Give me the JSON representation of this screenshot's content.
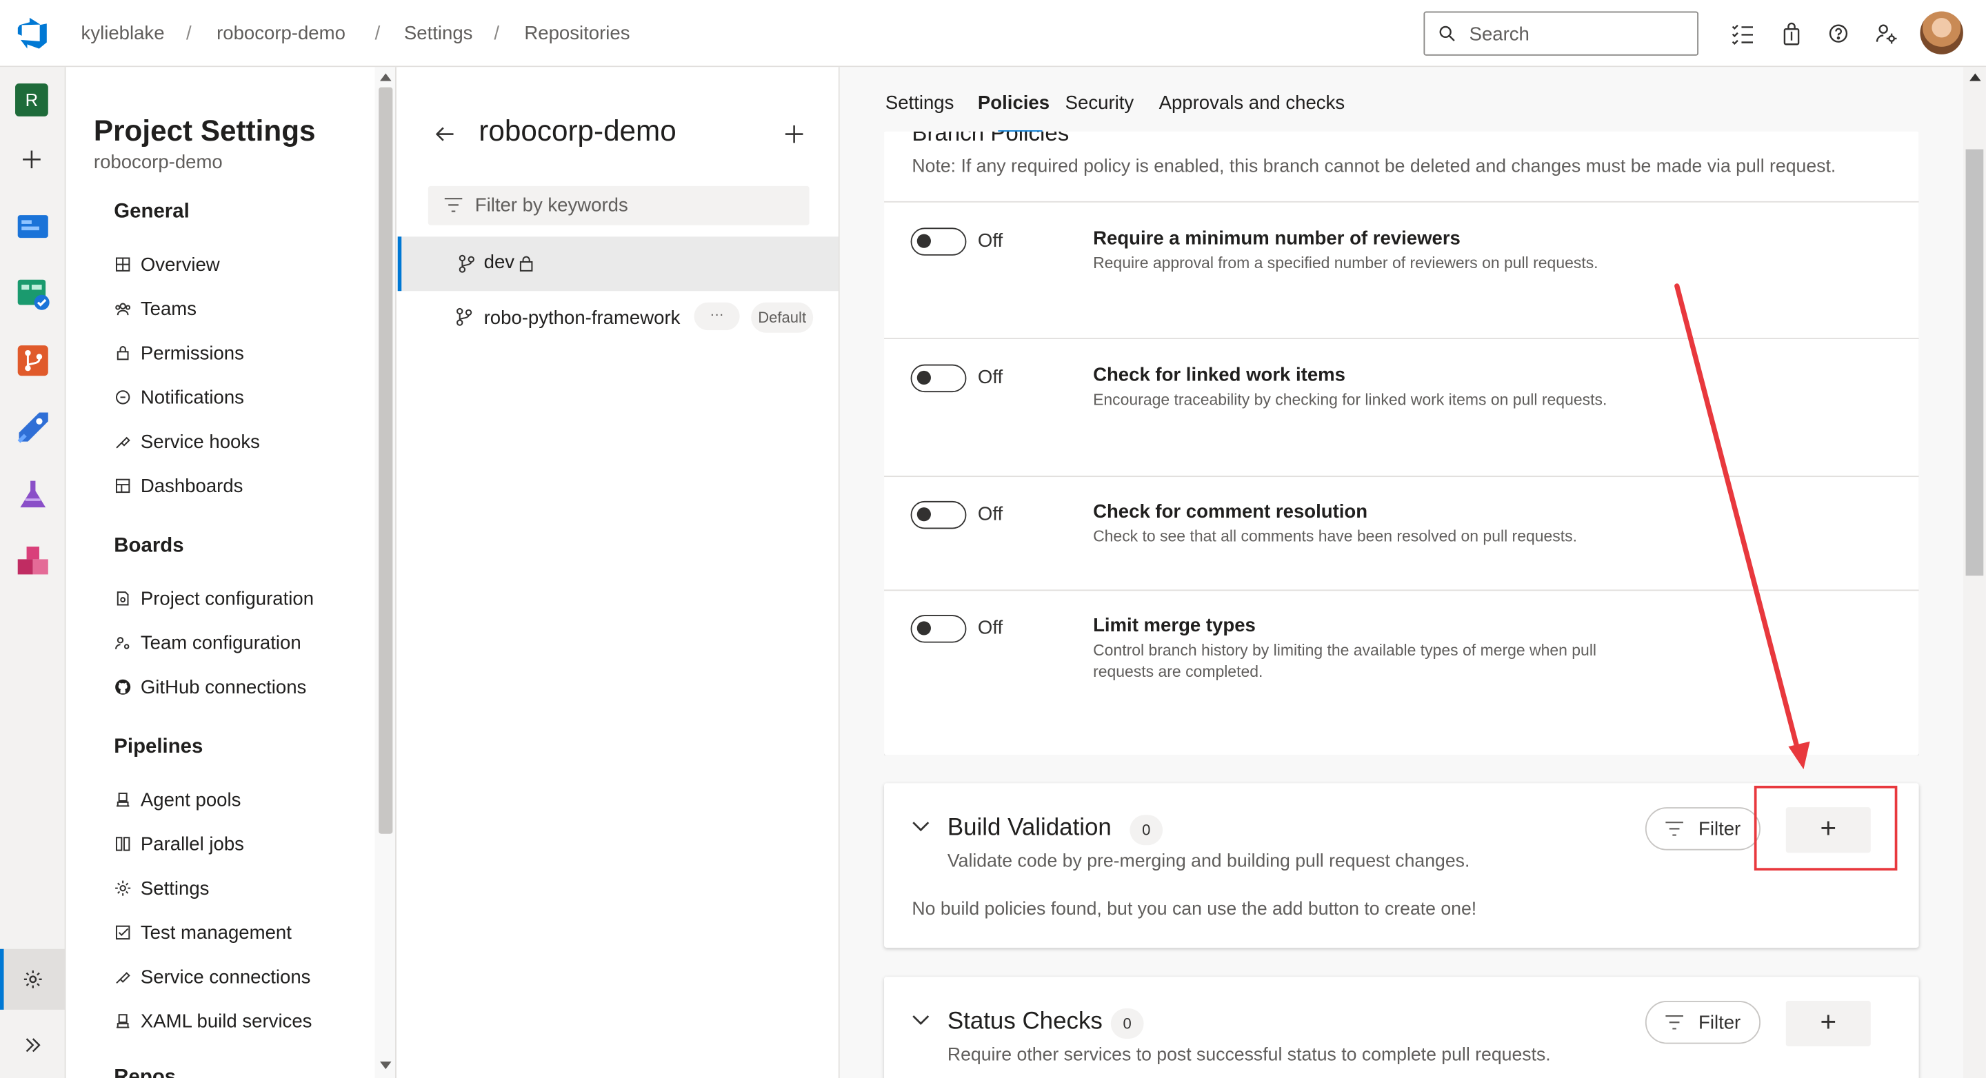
{
  "breadcrumb": {
    "org": "kylieblake",
    "project": "robocorp-demo",
    "section": "Settings",
    "page": "Repositories"
  },
  "search": {
    "placeholder": "Search"
  },
  "rail": {
    "project_initial": "R"
  },
  "nav": {
    "title": "Project Settings",
    "subtitle": "robocorp-demo",
    "sections": [
      {
        "label": "General",
        "items": [
          "Overview",
          "Teams",
          "Permissions",
          "Notifications",
          "Service hooks",
          "Dashboards"
        ]
      },
      {
        "label": "Boards",
        "items": [
          "Project configuration",
          "Team configuration",
          "GitHub connections"
        ]
      },
      {
        "label": "Pipelines",
        "items": [
          "Agent pools",
          "Parallel jobs",
          "Settings",
          "Test management",
          "Service connections",
          "XAML build services"
        ]
      },
      {
        "label": "Repos",
        "items": []
      }
    ]
  },
  "repo_panel": {
    "title": "robocorp-demo",
    "filter_placeholder": "Filter by keywords",
    "branches": [
      {
        "name": "dev",
        "selected": true,
        "locked": true
      },
      {
        "name": "robo-python-framework",
        "more": "···",
        "badge": "Default"
      }
    ]
  },
  "tabs": [
    {
      "label": "Settings"
    },
    {
      "label": "Policies",
      "active": true
    },
    {
      "label": "Security"
    },
    {
      "label": "Approvals and checks"
    }
  ],
  "branch_policies": {
    "heading": "Branch Policies",
    "note": "Note: If any required policy is enabled, this branch cannot be deleted and changes must be made via pull request.",
    "policies": [
      {
        "state": "Off",
        "title": "Require a minimum number of reviewers",
        "desc": "Require approval from a specified number of reviewers on pull requests."
      },
      {
        "state": "Off",
        "title": "Check for linked work items",
        "desc": "Encourage traceability by checking for linked work items on pull requests."
      },
      {
        "state": "Off",
        "title": "Check for comment resolution",
        "desc": "Check to see that all comments have been resolved on pull requests."
      },
      {
        "state": "Off",
        "title": "Limit merge types",
        "desc": "Control branch history by limiting the available types of merge when pull requests are completed."
      }
    ]
  },
  "build_validation": {
    "title": "Build Validation",
    "count": "0",
    "desc": "Validate code by pre-merging and building pull request changes.",
    "empty": "No build policies found, but you can use the add button to create one!",
    "filter": "Filter",
    "add": "+"
  },
  "status_checks": {
    "title": "Status Checks",
    "count": "0",
    "desc": "Require other services to post successful status to complete pull requests.",
    "filter": "Filter",
    "add": "+"
  },
  "colors": {
    "accent": "#0078d4",
    "annotation": "#e8383d"
  }
}
